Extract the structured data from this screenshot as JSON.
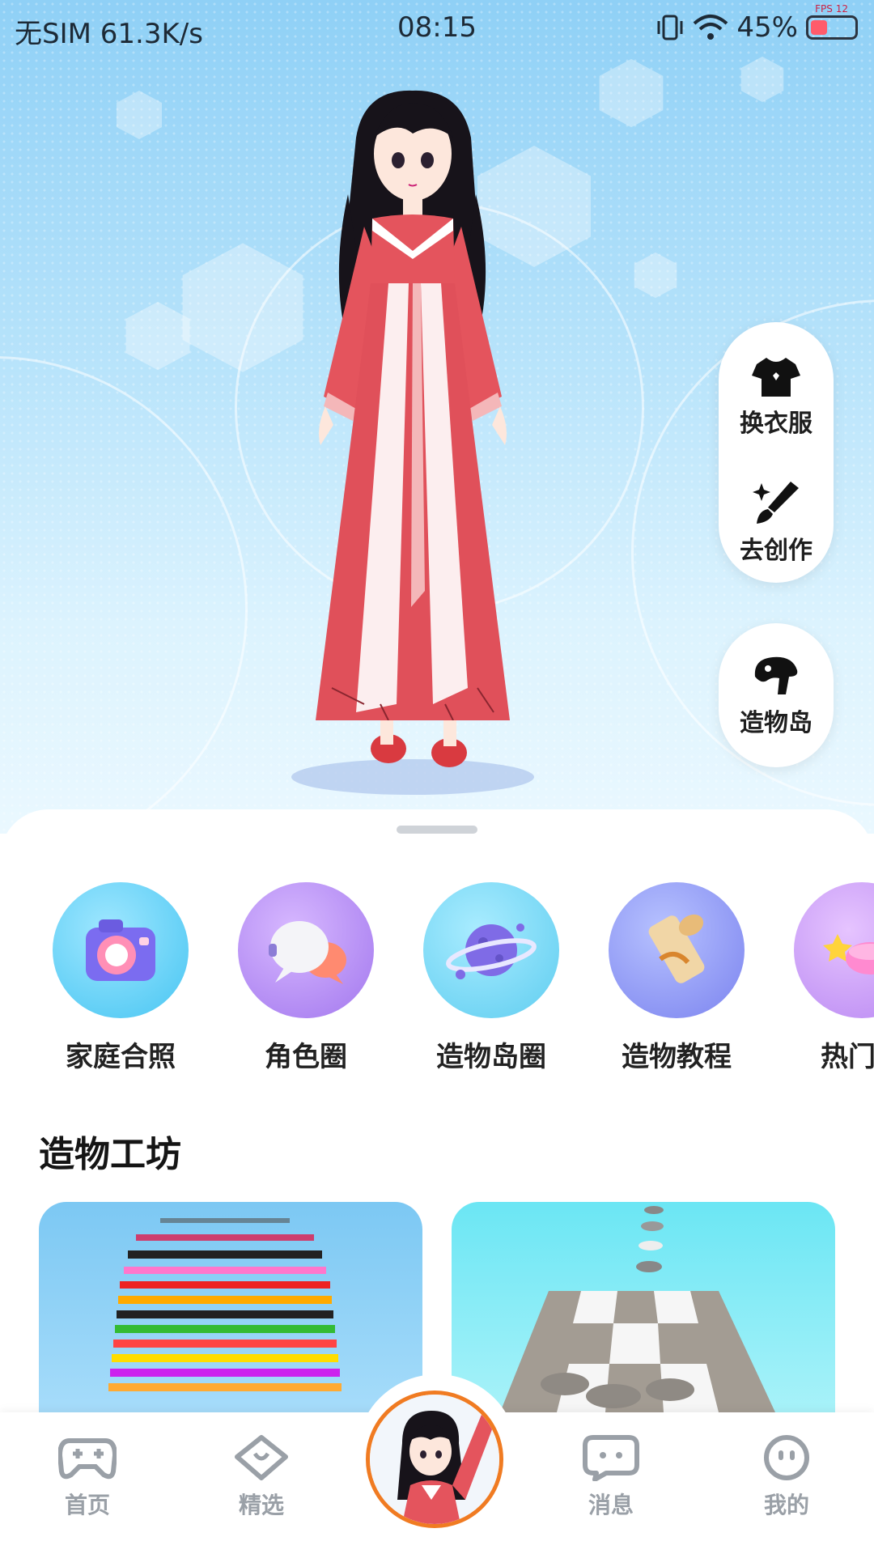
{
  "status_bar": {
    "left": "无SIM 61.3K/s",
    "time": "08:15",
    "battery": "45%",
    "fps": "FPS 12"
  },
  "side_actions": {
    "change_clothes": "换衣服",
    "create": "去创作",
    "island": "造物岛"
  },
  "shortcuts": [
    {
      "label": "家庭合照",
      "icon": "camera-icon"
    },
    {
      "label": "角色圈",
      "icon": "chat-bubbles-icon"
    },
    {
      "label": "造物岛圈",
      "icon": "planet-icon"
    },
    {
      "label": "造物教程",
      "icon": "scroll-icon"
    },
    {
      "label": "热门话",
      "icon": "trending-icon"
    }
  ],
  "section": {
    "title": "造物工坊"
  },
  "nav": {
    "home": "首页",
    "featured": "精选",
    "messages": "消息",
    "me": "我的"
  },
  "colors": {
    "accent": "#f07b22",
    "nav_text": "#9aa0a7",
    "hero_top": "#8fd0f6",
    "hero_bottom": "#eaf8ff"
  }
}
